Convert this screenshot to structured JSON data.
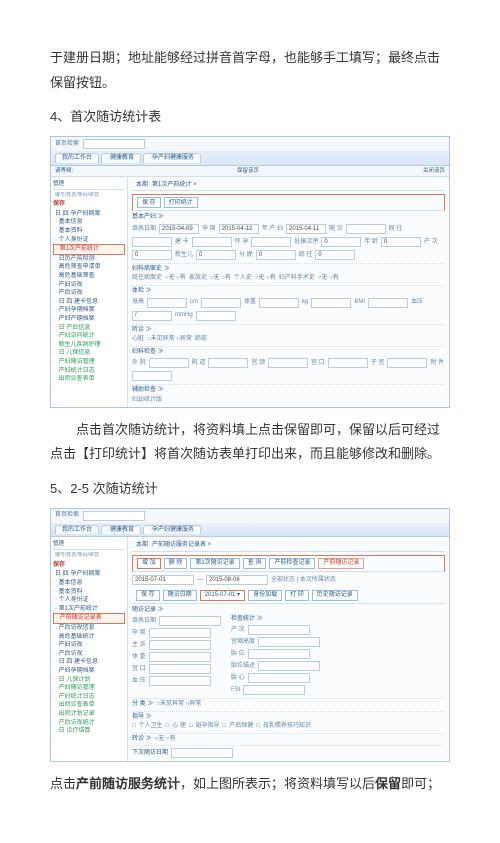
{
  "paragraphs": {
    "p0": "于建册日期；地址能够经过拼音首字母，也能够手工填写；最终点击保留按钮。",
    "s1_no": "4、",
    "s1_title": "首次随访统计表",
    "p1": "点击首次随访统计，将资料填上点击保留即可，保留以后可经过点击【打印统计】将首次随访表单打印出来，而且能够修改和删除。",
    "s2_no": "5、",
    "s2_title": "2-5 次随访统计",
    "p2a": "点击",
    "p2b": "产前随访服务统计",
    "p2c": "，如上图所表示；将资料填写以后",
    "p2d": "保留",
    "p2e": "即可；"
  },
  "shot1": {
    "search_label": "首页检索",
    "tabs": [
      "我的工作台",
      "·健康教育",
      "·孕产妇健康服务"
    ],
    "right_links": [
      "请等候: ",
      "保留该页",
      "关闭该页"
    ],
    "tree_header_left": "管理",
    "tree_header_right": "管理",
    "tree_search": "编号/姓名/条码/拼音",
    "tree_btn": "查找",
    "tree_badge": "保存",
    "tree": [
      {
        "t": "日 四 孕产妇病案",
        "c": ""
      },
      {
        "t": "· 基本信息",
        "c": ""
      },
      {
        "t": "· 基本资料",
        "c": ""
      },
      {
        "t": "· 个人身份证",
        "c": ""
      },
      {
        "t": "· 第1次产前统计",
        "c": "hl"
      },
      {
        "t": "· 日历产前检测",
        "c": ""
      },
      {
        "t": "· 高危筛查申请单",
        "c": ""
      },
      {
        "t": "· 高危基础筛查",
        "c": ""
      },
      {
        "t": "· 产妇访视",
        "c": ""
      },
      {
        "t": "· 产后访视",
        "c": ""
      },
      {
        "t": "· 日 四 建卡信息",
        "c": ""
      },
      {
        "t": "· 产妇孕期档案",
        "c": ""
      },
      {
        "t": "· 产妇产期档案",
        "c": ""
      },
      {
        "t": "· 日 产后信息",
        "c": "tg"
      },
      {
        "t": "· 产妇访问统计",
        "c": "tg"
      },
      {
        "t": "· 新生儿疾病护理",
        "c": "tg"
      },
      {
        "t": "· 日 儿保信息",
        "c": "tg"
      },
      {
        "t": "· 产妇随访管理",
        "c": "tg"
      },
      {
        "t": "· 产妇统计日志",
        "c": "tg"
      },
      {
        "t": "· 出院诊查表单",
        "c": "tg"
      }
    ],
    "breadcrumb": [
      "本期",
      "第1次产前统计 ×"
    ],
    "topbtns": [
      {
        "t": "保 存",
        "c": ""
      },
      {
        "t": "打印统计",
        "c": ""
      }
    ],
    "basic_hdr": "基本产妇 ≫",
    "basic": [
      {
        "l": "填表日期",
        "v": "2015-04-09"
      },
      {
        "l": "孕 周",
        "v": "2015-04-12"
      },
      {
        "l": "年 产 妇",
        "v": "2015-04-11"
      },
      {
        "l": "随 诊",
        "v": ""
      },
      {
        "l": "既 往",
        "v": ""
      },
      {
        "l": "建 卡",
        "v": ""
      },
      {
        "l": "怀 孕",
        "v": ""
      },
      {
        "l": "妊娠次序",
        "v": "0"
      },
      {
        "l": "年 龄",
        "v": "0"
      },
      {
        "l": "产 次",
        "v": "0"
      },
      {
        "l": "新生儿",
        "v": "0"
      },
      {
        "l": "分 娩",
        "v": "0"
      },
      {
        "l": "既 往",
        "v": "0"
      }
    ],
    "history_hdr": "妇科病案史 ≫",
    "history": [
      {
        "l": "既往病案史",
        "opts": "○无 ○有"
      },
      {
        "l": "家族史",
        "opts": "○无 ○有"
      },
      {
        "l": "个人史",
        "opts": "○无 ○有"
      },
      {
        "l": "妇产科手术史",
        "opts": "○无 ○有"
      }
    ],
    "tiche_hdr": "体检 ≫",
    "tiche": [
      {
        "l": "身高",
        "v": ""
      },
      {
        "l": "cm",
        "v": ""
      },
      {
        "l": "体重",
        "v": ""
      },
      {
        "l": "kg",
        "v": ""
      },
      {
        "l": "BMI",
        "v": ""
      },
      {
        "l": "血压",
        "v": "/"
      },
      {
        "l": "mmHg",
        "v": ""
      }
    ],
    "tingzhen_hdr": "听诊 ≫",
    "tingzhen": [
      {
        "l": "心脏",
        "opts": "○未见异常 ○异常"
      },
      {
        "l": "肺部",
        "opts": ""
      }
    ],
    "fuke_hdr": "妇科检查 ≫",
    "fuke": [
      {
        "l": "外 阴",
        "v": ""
      },
      {
        "l": "阴 道",
        "v": ""
      },
      {
        "l": "宫 颈",
        "v": ""
      },
      {
        "l": "宫 口",
        "v": ""
      },
      {
        "l": "子 宫",
        "v": ""
      },
      {
        "l": "附 件",
        "v": ""
      }
    ],
    "aux_hdr": "辅助检查 ≫",
    "footer": "妇幼统计版"
  },
  "shot2": {
    "search_label": "首页检索",
    "tabs": [
      "我的工作台",
      "·健康教育",
      "·孕产妇健康服务"
    ],
    "breadcrumb": [
      "本期",
      "产前随访服务记录表 ×"
    ],
    "topbtns": [
      {
        "t": "增 加",
        "c": "hl2"
      },
      {
        "t": "删 除",
        "c": ""
      },
      {
        "t": "第1次随访记录",
        "c": ""
      },
      {
        "t": "查 询",
        "c": ""
      },
      {
        "t": "产前检查记录",
        "c": ""
      },
      {
        "t": "产前随访记录",
        "c": "redbtn"
      }
    ],
    "daterow": {
      "d1": "2015-07-01",
      "d2": "2015-08-06",
      "links": "全部状态 | 本次所属状态"
    },
    "btnrow": [
      {
        "t": "保 存",
        "c": ""
      },
      {
        "t": "随访日期",
        "c": ""
      },
      {
        "t": "2015-07-01 ▾",
        "c": "hl2"
      },
      {
        "t": "身份加载",
        "c": ""
      },
      {
        "t": "打 印",
        "c": ""
      },
      {
        "t": "历史随访记录",
        "c": ""
      }
    ],
    "check_hdr": "随访记录 ≫",
    "check_left": [
      {
        "l": "填表日期",
        "v": ""
      },
      {
        "l": "孕 周",
        "v": ""
      },
      {
        "l": "主 诉",
        "v": ""
      },
      {
        "l": "体 重",
        "v": ""
      },
      {
        "l": "宫 口",
        "v": ""
      },
      {
        "l": "血 压",
        "v": ""
      }
    ],
    "check_right_hdr": "检查统计 ≫",
    "check_right": [
      {
        "l": "产 次",
        "v": ""
      },
      {
        "l": "宫缩高度",
        "v": ""
      },
      {
        "l": "胎 位",
        "v": ""
      },
      {
        "l": "胎位描述",
        "v": ""
      },
      {
        "l": "胎 心",
        "v": ""
      },
      {
        "l": "FSI",
        "v": ""
      }
    ],
    "category": "分 类 ≫",
    "category_opt": "○未见异常 ○异常",
    "guide_hdr": "指导 ≫",
    "guide": [
      {
        "l": "个人卫生",
        "opt": "□"
      },
      {
        "l": "心 理",
        "opt": "□"
      },
      {
        "l": "避孕指导",
        "opt": "□"
      },
      {
        "l": "产后保健",
        "opt": "□"
      },
      {
        "l": "母乳喂养技巧知识",
        "opt": "□"
      }
    ],
    "transfer_hdr": "转诊 ≫",
    "transfer_opt": "○无 ○有",
    "next_hdr": "下次随访日期",
    "tree_header_left": "管理",
    "tree_search": "编号/姓名/条码/拼音",
    "tree_btn": "查找",
    "tree_badge": "保存",
    "tree": [
      {
        "t": "日 四 孕产妇病案",
        "c": ""
      },
      {
        "t": "· 基本信息",
        "c": ""
      },
      {
        "t": "· 基本资料",
        "c": ""
      },
      {
        "t": "· 个人身份证",
        "c": ""
      },
      {
        "t": "· 第1次产前统计",
        "c": ""
      },
      {
        "t": "· 产前随访记录表",
        "c": "hl"
      },
      {
        "t": "· 产后访视信息",
        "c": ""
      },
      {
        "t": "· 高危基础统计",
        "c": ""
      },
      {
        "t": "· 产妇访视",
        "c": ""
      },
      {
        "t": "· 产后访视",
        "c": ""
      },
      {
        "t": "· 日 四 建卡信息",
        "c": ""
      },
      {
        "t": "· 产妇孕期档案",
        "c": ""
      },
      {
        "t": "· 日 儿保计划",
        "c": "tg"
      },
      {
        "t": "· 产妇随访管理",
        "c": "tg"
      },
      {
        "t": "· 产妇统计日志",
        "c": "tg"
      },
      {
        "t": "· 出院诊查表单",
        "c": "tg"
      },
      {
        "t": "· 出院计划记录",
        "c": "tg"
      },
      {
        "t": "· 产后访视统计",
        "c": "tg"
      },
      {
        "t": "· 日 诊疗结算",
        "c": "tg"
      }
    ]
  }
}
